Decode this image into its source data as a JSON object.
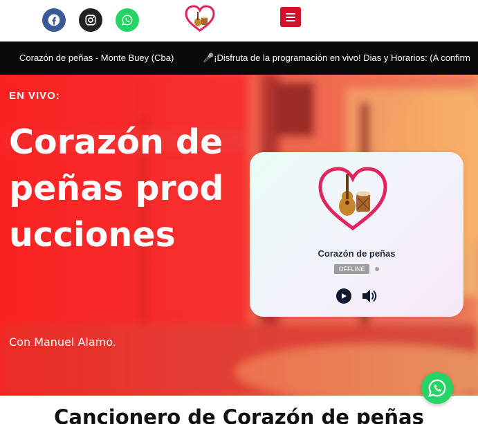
{
  "header": {
    "social": [
      {
        "name": "facebook-icon"
      },
      {
        "name": "instagram-icon"
      },
      {
        "name": "whatsapp-icon"
      }
    ],
    "logo_icon": "heart-guitar-drum-logo",
    "menu_icon": "hamburger-menu-icon"
  },
  "ticker": {
    "station": "Corazón de peñas - Monte Buey (Cba)",
    "message": "🎤¡Disfruta de la programación en vivo! Dias y Horarios: (A confirm"
  },
  "hero": {
    "live_label": "EN VIVO:",
    "title": "Corazón de peñas producciones",
    "host": "Con Manuel Alamo."
  },
  "player": {
    "station_name": "Corazón de peñas",
    "status": "OFFLINE",
    "logo_caption": "Corazón de peñas",
    "play_icon": "play-icon",
    "volume_icon": "volume-icon"
  },
  "section": {
    "heading": "Cancionero de Corazón de peñas"
  },
  "colors": {
    "brand_red": "#d1122a",
    "ticker_bg": "#0a0a0a",
    "whatsapp_green": "#25d366",
    "facebook_blue": "#3b5998"
  }
}
